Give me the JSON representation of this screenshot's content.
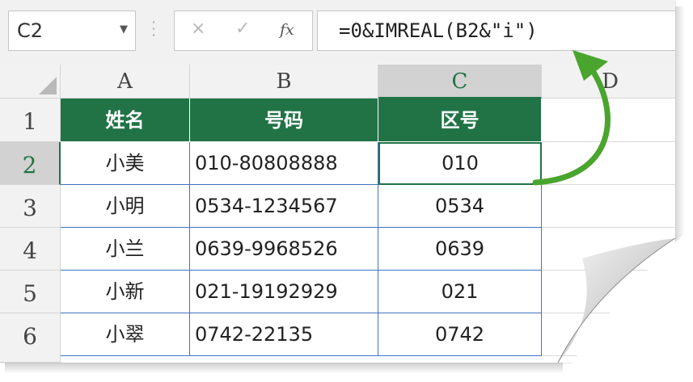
{
  "name_box": {
    "value": "C2"
  },
  "formula_bar": {
    "cancel_icon": "×",
    "enter_icon": "✓",
    "fx_label": "fx",
    "formula": "=0&IMREAL(B2&\"i\")"
  },
  "columns": [
    "A",
    "B",
    "C",
    "D"
  ],
  "rows": [
    "1",
    "2",
    "3",
    "4",
    "5",
    "6"
  ],
  "table": {
    "headers": [
      "姓名",
      "号码",
      "区号"
    ],
    "records": [
      [
        "小美",
        "010-80808888",
        "010"
      ],
      [
        "小明",
        "0534-1234567",
        "0534"
      ],
      [
        "小兰",
        "0639-9968526",
        "0639"
      ],
      [
        "小新",
        "021-19192929",
        "021"
      ],
      [
        "小翠",
        "0742-22135",
        "0742"
      ]
    ]
  },
  "colors": {
    "header_fill": "#217346",
    "cell_border": "#4472c4",
    "selection": "#217346",
    "arrow": "#4aa52e"
  },
  "selected_cell": "C2"
}
